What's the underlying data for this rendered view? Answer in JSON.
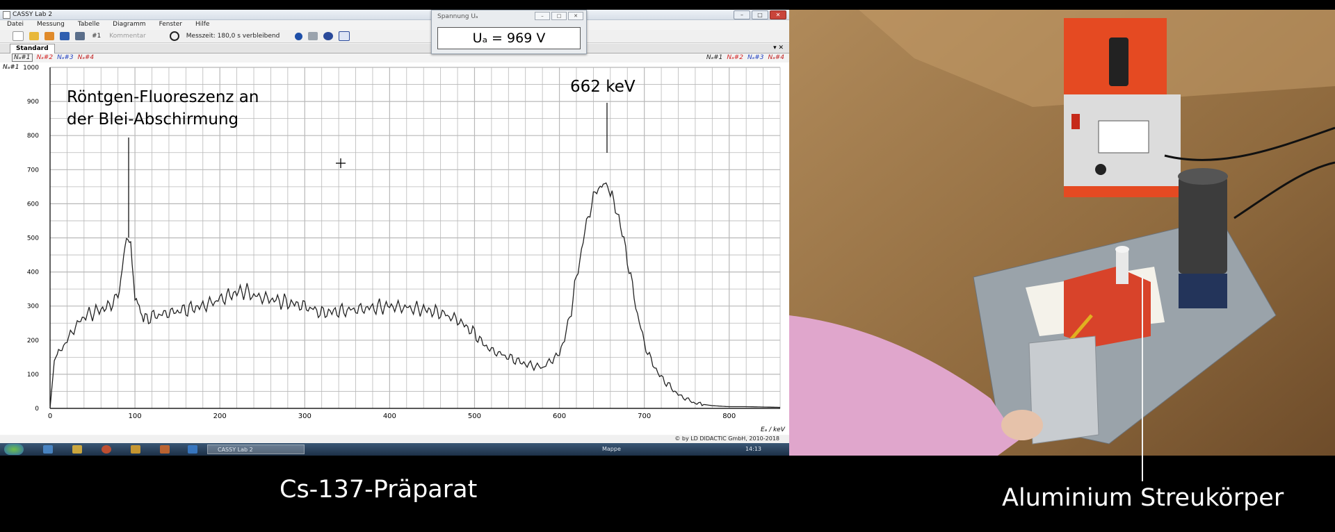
{
  "app": {
    "title": "CASSY Lab 2",
    "window_buttons": [
      "–",
      "□",
      "✕"
    ]
  },
  "menu": [
    "Datei",
    "Messung",
    "Tabelle",
    "Diagramm",
    "Fenster",
    "Hilfe"
  ],
  "toolbar": {
    "series_select": "#1",
    "comment_placeholder": "Kommentar",
    "timer": "Messzeit: 180,0 s verbleibend"
  },
  "tabs": {
    "active": "Standard",
    "controls": "▾ ✕"
  },
  "series_left": [
    "Nₐ#1",
    "Nₐ#2",
    "Nₐ#3",
    "Nₐ#4"
  ],
  "series_right": [
    "Nₐ#1",
    "Nₐ#2",
    "Nₐ#3",
    "Nₐ#4"
  ],
  "status": {
    "copyright": "© by LD DIDACTIC GmbH, 2010-2018"
  },
  "taskbar": {
    "task_label": "CASSY Lab 2",
    "tray_text": "Mappe",
    "clock": "14:13"
  },
  "popup": {
    "title": "Spannung Uₐ",
    "readout": "Uₐ =  969 V",
    "buttons": [
      "–",
      "□",
      "✕"
    ]
  },
  "colors": {
    "series1": "#222222",
    "series2": "#d42020",
    "series3": "#2040c0",
    "grid": "#b8b8b8",
    "accent": "#e8502a"
  },
  "chart_data": {
    "type": "line",
    "xlabel": "Eₐ / keV",
    "ylabel": "Nₐ#1",
    "xlim": [
      0,
      860
    ],
    "ylim": [
      0,
      1000
    ],
    "x_ticks": [
      0,
      100,
      200,
      300,
      400,
      500,
      600,
      700,
      800
    ],
    "y_ticks": [
      0,
      100,
      200,
      300,
      400,
      500,
      600,
      700,
      800,
      900,
      1000
    ],
    "grid": true,
    "series": [
      {
        "x": [
          0,
          5,
          10,
          20,
          30,
          40,
          50,
          60,
          70,
          80,
          85,
          90,
          95,
          100,
          105,
          110,
          120,
          140,
          160,
          180,
          200,
          220,
          230,
          240,
          260,
          280,
          300,
          320,
          340,
          360,
          380,
          400,
          420,
          440,
          460,
          480,
          500,
          510,
          520,
          530,
          540,
          560,
          580,
          600,
          610,
          620,
          630,
          640,
          650,
          655,
          660,
          670,
          680,
          690,
          700,
          710,
          720,
          740,
          760,
          780,
          800,
          820,
          840,
          860
        ],
        "y": [
          0,
          140,
          160,
          200,
          240,
          270,
          280,
          290,
          300,
          330,
          400,
          480,
          490,
          310,
          280,
          260,
          270,
          280,
          290,
          300,
          320,
          340,
          345,
          330,
          320,
          310,
          300,
          280,
          285,
          290,
          295,
          300,
          295,
          290,
          280,
          260,
          220,
          190,
          170,
          160,
          150,
          130,
          120,
          160,
          240,
          380,
          520,
          620,
          660,
          650,
          630,
          560,
          440,
          300,
          190,
          130,
          90,
          40,
          15,
          8,
          5,
          5,
          4,
          3
        ]
      }
    ],
    "annotations": [
      {
        "text": "Röntgen-Fluoreszenz an der Blei-Abschirmung",
        "x": 93,
        "y": 510
      },
      {
        "text": "662 keV",
        "x": 652,
        "y": 710
      }
    ]
  },
  "annotation_line1": "Röntgen-Fluoreszenz an",
  "annotation_line2": "der Blei-Abschirmung",
  "annotation_peak": "662 keV",
  "captions": {
    "left": "Cs-137-Präparat",
    "right": "Aluminium Streukörper"
  }
}
